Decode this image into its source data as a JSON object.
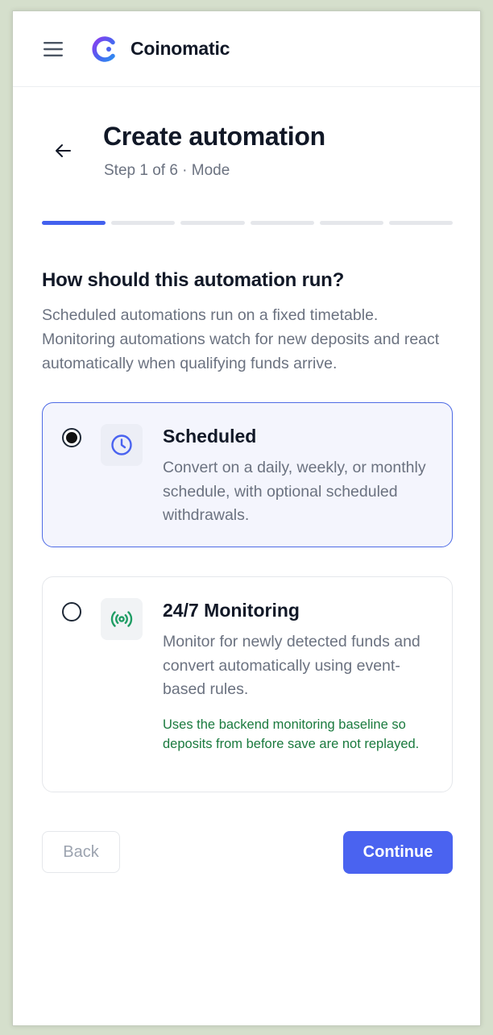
{
  "app": {
    "brand": "Coinomatic"
  },
  "header": {
    "title": "Create automation",
    "subtitle": "Step 1 of 6 · Mode"
  },
  "progress": {
    "current_step": 1,
    "total_steps": 6
  },
  "question": {
    "title": "How should this automation run?",
    "description": "Scheduled automations run on a fixed timetable. Monitoring automations watch for new deposits and react automatically when qualifying funds arrive."
  },
  "options": [
    {
      "title": "Scheduled",
      "description": "Convert on a daily, weekly, or monthly schedule, with optional scheduled withdrawals.",
      "icon": "clock-icon",
      "selected": true
    },
    {
      "title": "24/7 Monitoring",
      "description": "Monitor for newly detected funds and convert automatically using event-based rules.",
      "note": "Uses the backend monitoring baseline so deposits from before save are not replayed.",
      "icon": "broadcast-icon",
      "selected": false
    }
  ],
  "actions": {
    "back_label": "Back",
    "continue_label": "Continue"
  },
  "colors": {
    "accent": "#4a63f0",
    "selected_border": "#4e6be5",
    "selected_bg": "#f4f5fd",
    "note_green": "#1a7a3e",
    "monitor_icon_green": "#1f9d64"
  }
}
